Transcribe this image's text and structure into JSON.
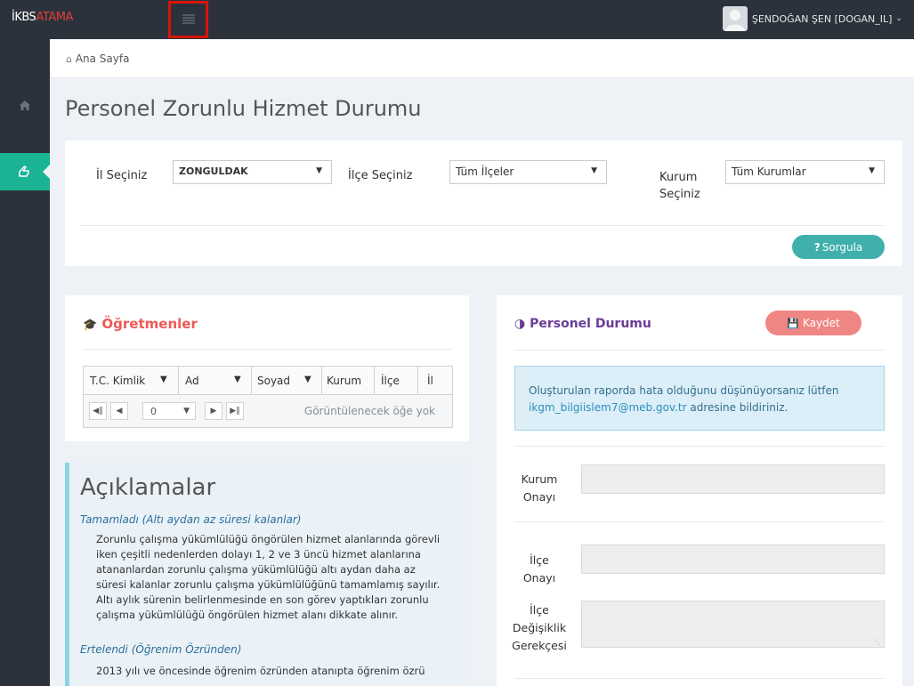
{
  "app": {
    "brand_part1": "İKBS",
    "brand_part2": "ATAMA"
  },
  "user": {
    "name": "ŞENDOĞAN ŞEN [DOGAN_IL]"
  },
  "breadcrumb": {
    "label": "Ana Sayfa"
  },
  "page": {
    "title": "Personel Zorunlu Hizmet Durumu"
  },
  "filter": {
    "il_label": "İl Seçiniz",
    "il_value": "ZONGULDAK",
    "ilce_label": "İlçe Seçiniz",
    "ilce_value": "Tüm İlçeler",
    "kurum_label_1": "Kurum",
    "kurum_label_2": "Seçiniz",
    "kurum_value": "Tüm Kurumlar",
    "query_button": "Sorgula"
  },
  "teachers": {
    "title": "Öğretmenler",
    "columns": [
      "T.C. Kimlik",
      "Ad",
      "Soyad",
      "Kurum",
      "İlçe",
      "İl"
    ],
    "page_value": "0",
    "empty_text": "Görüntülenecek öğe yok"
  },
  "personel": {
    "title": "Personel Durumu",
    "save_button": "Kaydet",
    "alert_text": "Oluşturulan raporda hata olduğunu düşünüyorsanız lütfen",
    "alert_mail": "ikgm_bilgiislem7@meb.gov.tr",
    "alert_suffix": " adresine bildiriniz.",
    "kurum_onay_1": "Kurum",
    "kurum_onay_2": "Onayı",
    "ilce_onay_1": "İlçe",
    "ilce_onay_2": "Onayı",
    "ilce_deg_1": "İlçe",
    "ilce_deg_2": "Değişiklik",
    "ilce_deg_3": "Gerekçesi"
  },
  "aciklamalar": {
    "title": "Açıklamalar",
    "sub1": "Tamamladı (Altı aydan az süresi kalanlar)",
    "text1_lines": [
      "Zorunlu çalışma yükümlülüğü öngörülen hizmet alanlarında görevli",
      "iken çeşitli nedenlerden dolayı 1, 2 ve 3 üncü hizmet alanlarına",
      "atananlardan zorunlu çalışma yükümlülüğü altı aydan daha az",
      "süresi kalanlar zorunlu çalışma yükümlülüğünü tamamlamış sayılır.",
      "Altı aylık sürenin belirlenmesinde en son görev yaptıkları zorunlu",
      "çalışma yükümlülüğü öngörülen hizmet alanı dikkate alınır."
    ],
    "sub2": "Ertelendi (Öğrenim Özründen)",
    "text2": "2013 yılı ve öncesinde öğrenim özründen atanıpta öğrenim özrü"
  }
}
